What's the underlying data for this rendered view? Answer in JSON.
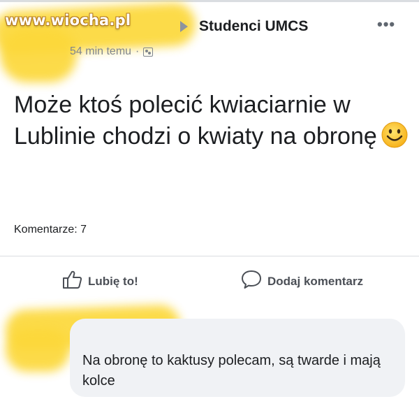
{
  "watermark": "www.wiocha.pl",
  "header": {
    "group_name": "Studenci UMCS",
    "time": "54 min temu",
    "separator": "·",
    "privacy_icon": "group-icon",
    "more_icon": "•••"
  },
  "post": {
    "text": "Może ktoś polecić kwiaciarnie w Lublinie chodzi o kwiaty na obronę",
    "emoji": "smiley"
  },
  "stats": {
    "comments": "Komentarze: 7"
  },
  "actions": {
    "like_label": "Lubię to!",
    "comment_label": "Dodaj komentarz"
  },
  "comment": {
    "text": "Na obronę to kaktusy polecam, są twarde i mają kolce"
  },
  "colors": {
    "highlighter": "#fcd83a",
    "text": "#1c1e21",
    "muted": "#7f858c",
    "bubble": "#f0f2f5"
  }
}
